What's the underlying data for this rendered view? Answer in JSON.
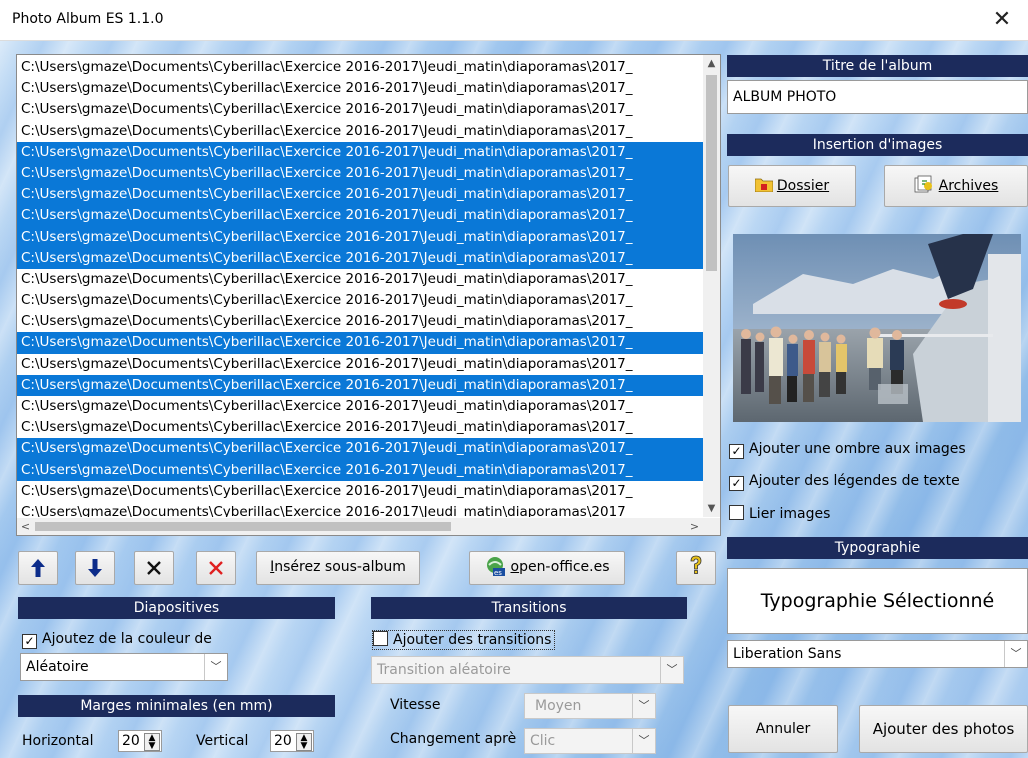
{
  "window": {
    "title": "Photo Album ES 1.1.0",
    "close_glyph": "✕"
  },
  "file_list": {
    "path": "C:\\Users\\gmaze\\Documents\\Cyberillac\\Exercice 2016-2017\\Jeudi_matin\\diaporamas\\2017_",
    "rows": [
      {
        "selected": false
      },
      {
        "selected": false
      },
      {
        "selected": false
      },
      {
        "selected": false
      },
      {
        "selected": true
      },
      {
        "selected": true
      },
      {
        "selected": true
      },
      {
        "selected": true
      },
      {
        "selected": true
      },
      {
        "selected": true
      },
      {
        "selected": false
      },
      {
        "selected": false
      },
      {
        "selected": false
      },
      {
        "selected": true
      },
      {
        "selected": false
      },
      {
        "selected": true
      },
      {
        "selected": false
      },
      {
        "selected": false
      },
      {
        "selected": true
      },
      {
        "selected": true
      },
      {
        "selected": false
      },
      {
        "selected": false
      }
    ],
    "selection_color": "#0a78d7"
  },
  "toolbar": {
    "move_up_icon": "arrow-up-icon",
    "move_down_icon": "arrow-down-icon",
    "remove_icon": "remove-icon",
    "remove_all_icon": "remove-all-icon",
    "insert_subalbum_label": "Insérez sous-album",
    "insert_subalbum_mnemonic": "I",
    "openoffice_label": "open-office.es",
    "openoffice_mnemonic": "o",
    "help_icon": "help-icon"
  },
  "diapositives": {
    "header": "Diapositives",
    "color_checkbox_label": "Ajoutez de la couleur de",
    "color_checked": true,
    "color_value": "Aléatoire"
  },
  "margins": {
    "header": "Marges minimales (en mm)",
    "horizontal_label": "Horizontal",
    "horizontal_value": "20",
    "vertical_label": "Vertical",
    "vertical_value": "20"
  },
  "transitions": {
    "header": "Transitions",
    "checkbox_label": "Ajouter des transitions",
    "checked": false,
    "transition_value": "Transition aléatoire",
    "speed_label": "Vitesse",
    "speed_value": "Moyen",
    "change_label": "Changement aprè",
    "change_value": "Clic"
  },
  "album": {
    "title_header": "Titre de l'album",
    "title_value": "ALBUM PHOTO",
    "insert_header": "Insertion d'images",
    "folder_button": "Dossier",
    "archives_button": "Archives",
    "folder_icon": "folder-icon",
    "archives_icon": "archives-icon"
  },
  "options": {
    "shadow_label": "Ajouter une ombre aux images",
    "shadow_checked": true,
    "captions_label": "Ajouter des légendes de texte",
    "captions_checked": true,
    "link_label": "Lier images",
    "link_checked": false
  },
  "typography": {
    "header": "Typographie",
    "preview_text": "Typographie Sélectionné",
    "font_value": "Liberation Sans"
  },
  "actions": {
    "cancel_label": "Annuler",
    "add_photos_label": "Ajouter des photos"
  }
}
